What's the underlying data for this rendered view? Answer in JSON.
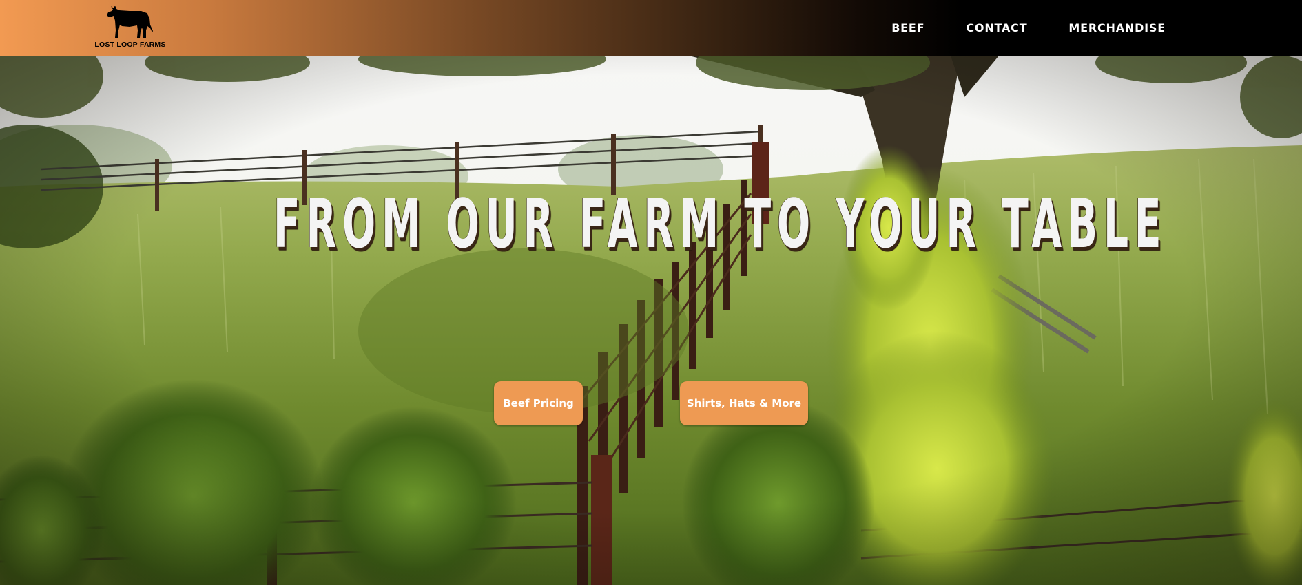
{
  "header": {
    "logo_text": "LOST LOOP FARMS",
    "logo_icon": "cow-icon",
    "nav": [
      {
        "label": "BEEF"
      },
      {
        "label": "CONTACT"
      },
      {
        "label": "MERCHANDISE"
      }
    ]
  },
  "hero": {
    "title": "FROM OUR FARM TO YOUR TABLE",
    "buttons": {
      "beef_pricing": "Beef Pricing",
      "merch": "Shirts, Hats & More"
    },
    "background": "farm-pasture-photo"
  },
  "colors": {
    "accent": "#ee9a53",
    "header_start": "#f29a52",
    "header_end": "#000000"
  }
}
